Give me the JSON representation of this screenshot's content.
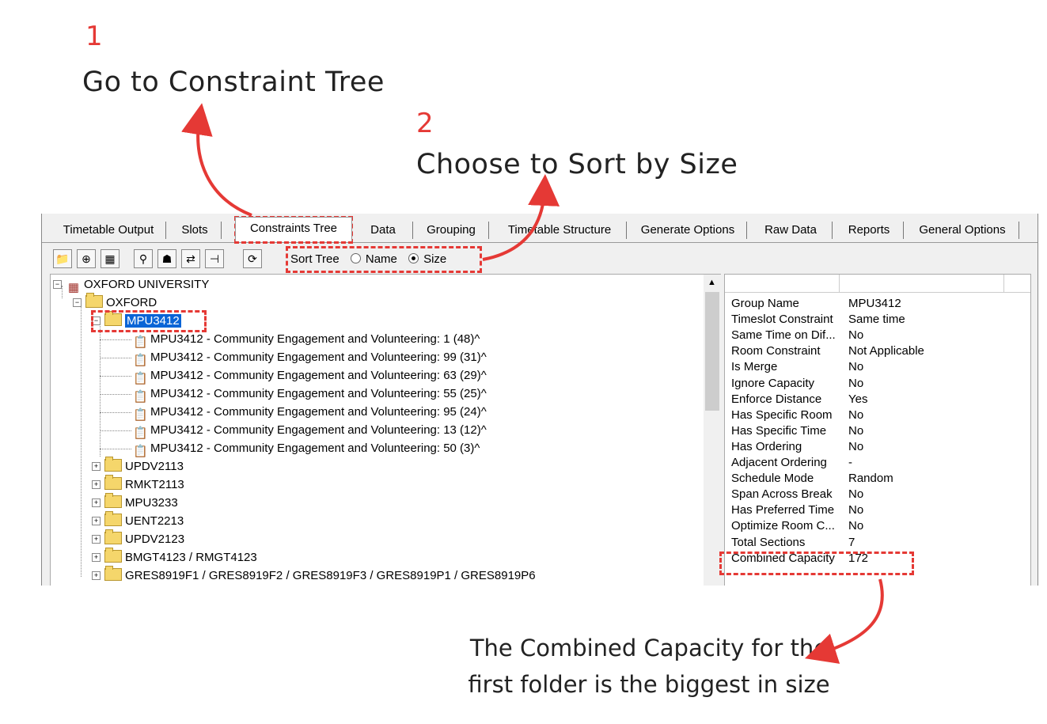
{
  "annotations": {
    "step1_number": "1",
    "step1_text": "Go to Constraint Tree",
    "step2_number": "2",
    "step2_text": "Choose to Sort by Size",
    "note_line1": "The Combined Capacity for the",
    "note_line2": "first folder is the biggest in size"
  },
  "tabs": [
    {
      "label": "Timetable Output"
    },
    {
      "label": "Slots"
    },
    {
      "label": "Constraints Tree"
    },
    {
      "label": "Data"
    },
    {
      "label": "Grouping"
    },
    {
      "label": "Timetable Structure"
    },
    {
      "label": "Generate Options"
    },
    {
      "label": "Raw Data"
    },
    {
      "label": "Reports"
    },
    {
      "label": "General Options"
    }
  ],
  "toolbar": {
    "icons": [
      "folder-icon",
      "class-icon",
      "grid-icon",
      "teacher-icon",
      "student-icon",
      "link-icon",
      "split-icon",
      "refresh-icon"
    ],
    "sort_label": "Sort Tree",
    "option_name": "Name",
    "option_size": "Size",
    "selected": "Size"
  },
  "tree": {
    "root": "OXFORD UNIVERSITY",
    "campus": "OXFORD",
    "selected_folder": "MPU3412",
    "children": [
      "MPU3412 - Community Engagement and Volunteering: 1 (48)^",
      "MPU3412 - Community Engagement and Volunteering: 99 (31)^",
      "MPU3412 - Community Engagement and Volunteering: 63 (29)^",
      "MPU3412 - Community Engagement and Volunteering: 55 (25)^",
      "MPU3412 - Community Engagement and Volunteering: 95 (24)^",
      "MPU3412 - Community Engagement and Volunteering: 13 (12)^",
      "MPU3412 - Community Engagement and Volunteering: 50 (3)^"
    ],
    "folders": [
      "UPDV2113",
      "RMKT2113",
      "MPU3233",
      "UENT2213",
      "UPDV2123",
      "BMGT4123 / RMGT4123",
      "GRES8919F1 / GRES8919F2 / GRES8919F3 / GRES8919P1 / GRES8919P6"
    ]
  },
  "properties": [
    {
      "key": "Group Name",
      "value": "MPU3412"
    },
    {
      "key": "Timeslot Constraint",
      "value": "Same time"
    },
    {
      "key": "Same Time on Dif...",
      "value": "No"
    },
    {
      "key": "Room Constraint",
      "value": "Not Applicable"
    },
    {
      "key": "Is Merge",
      "value": "No"
    },
    {
      "key": "Ignore Capacity",
      "value": "No"
    },
    {
      "key": "Enforce Distance",
      "value": "Yes"
    },
    {
      "key": "Has Specific Room",
      "value": "No"
    },
    {
      "key": "Has Specific Time",
      "value": "No"
    },
    {
      "key": "Has Ordering",
      "value": "No"
    },
    {
      "key": "Adjacent Ordering",
      "value": "-"
    },
    {
      "key": "Schedule Mode",
      "value": "Random"
    },
    {
      "key": "Span Across Break",
      "value": "No"
    },
    {
      "key": "Has Preferred Time",
      "value": "No"
    },
    {
      "key": "Optimize Room C...",
      "value": "No"
    },
    {
      "key": "Total Sections",
      "value": "7"
    },
    {
      "key": "Combined Capacity",
      "value": "172"
    }
  ],
  "colors": {
    "accent": "#e53935",
    "selection": "#0a64d6"
  }
}
